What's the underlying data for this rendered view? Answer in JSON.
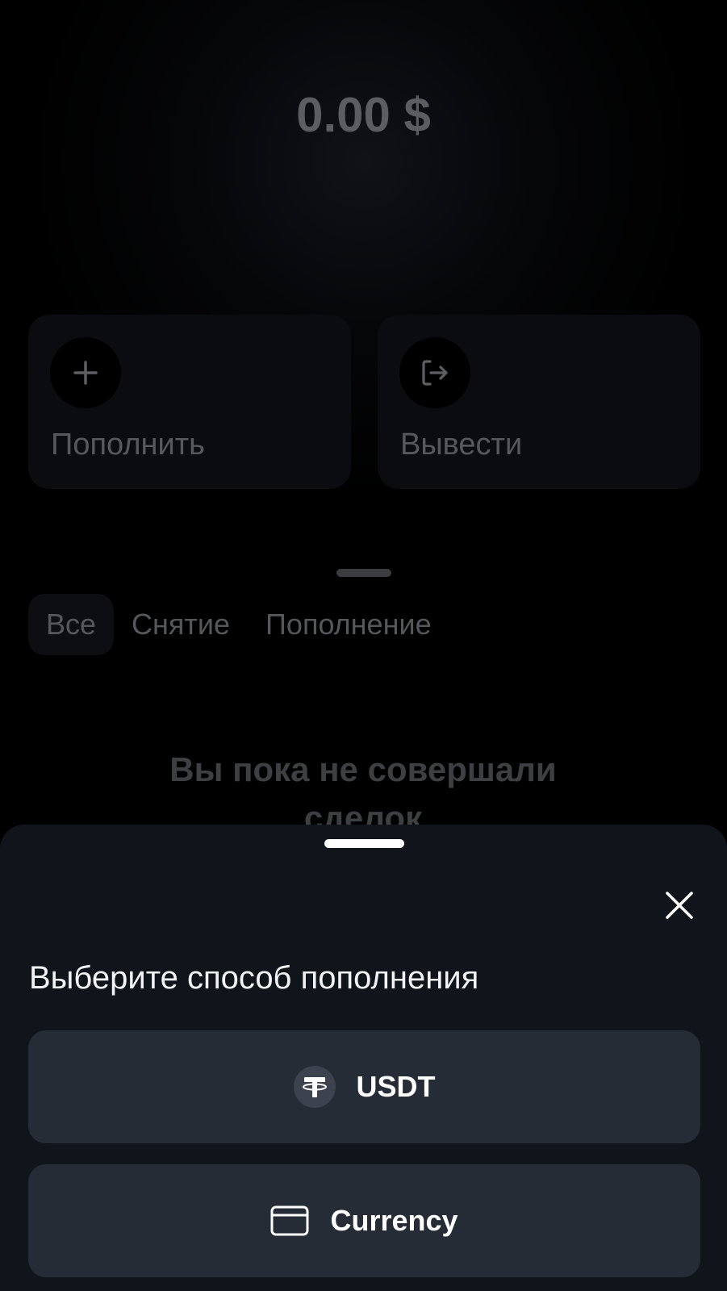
{
  "balance": {
    "amount": "0.00 $"
  },
  "actions": {
    "deposit_label": "Пополнить",
    "withdraw_label": "Вывести"
  },
  "tabs": [
    {
      "label": "Все",
      "active": true
    },
    {
      "label": "Снятие",
      "active": false
    },
    {
      "label": "Пополнение",
      "active": false
    }
  ],
  "empty_state": {
    "text": "Вы пока не совершали сделок"
  },
  "sheet": {
    "title": "Выберите способ пополнения",
    "methods": [
      {
        "label": "USDT",
        "icon": "tether-icon"
      },
      {
        "label": "Currency",
        "icon": "credit-card-icon"
      }
    ]
  },
  "colors": {
    "background": "#000000",
    "sheet_background": "#10151c",
    "method_button": "#262c36",
    "dimmed_text": "#56585c"
  }
}
